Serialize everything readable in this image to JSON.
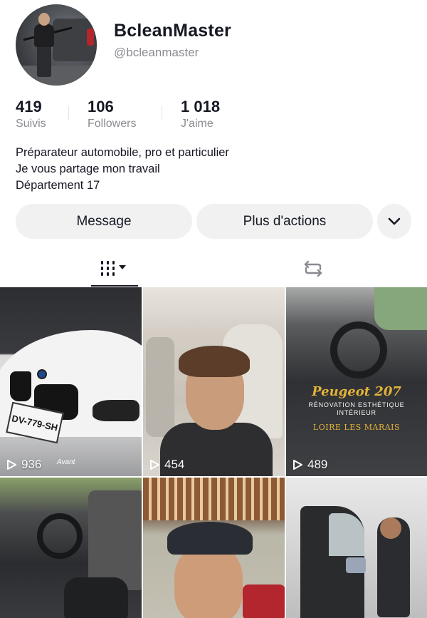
{
  "profile": {
    "display_name": "BcleanMaster",
    "handle": "@bcleanmaster"
  },
  "stats": [
    {
      "value": "419",
      "label": "Suivis"
    },
    {
      "value": "106",
      "label": "Followers"
    },
    {
      "value": "1 018",
      "label": "J'aime"
    }
  ],
  "bio": [
    "Préparateur automobile, pro et particulier",
    "Je vous partage mon travail",
    "Département 17"
  ],
  "actions": {
    "message": "Message",
    "more": "Plus d'actions"
  },
  "tabs": {
    "videos_icon": "grid-icon",
    "reposts_icon": "repost-icon"
  },
  "videos": [
    {
      "views": "936",
      "caption": "Avant"
    },
    {
      "views": "454"
    },
    {
      "views": "489",
      "title": "Peugeot 207",
      "subtitle_1": "RÉNOVATION ESTHÉTIQUE",
      "subtitle_2": "INTÉRIEUR",
      "location": "LOIRE LES MARAIS"
    },
    {
      "views": ""
    },
    {
      "views": ""
    },
    {
      "views": ""
    }
  ],
  "plate_text": "DV-779-SH"
}
